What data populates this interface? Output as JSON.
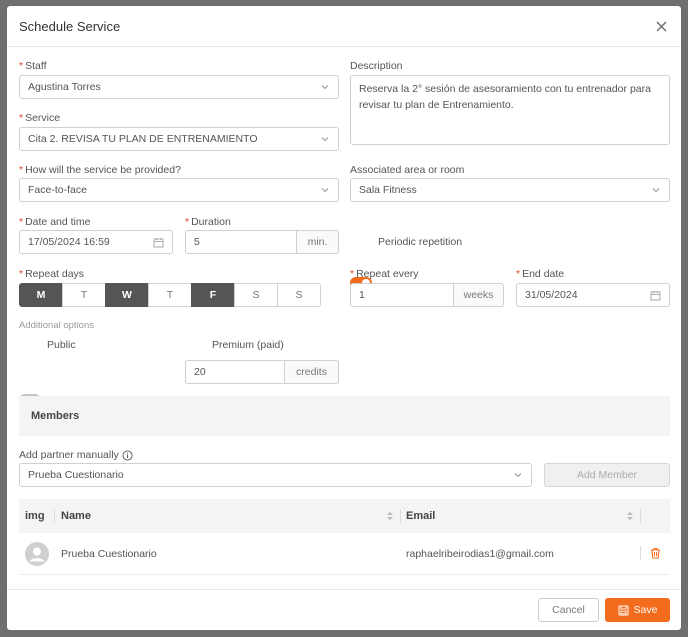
{
  "modal": {
    "title": "Schedule Service"
  },
  "staff": {
    "label": "Staff",
    "value": "Agustina Torres"
  },
  "description": {
    "label": "Description",
    "value": "Reserva la 2° sesión de asesoramiento con tu entrenador para revisar tu plan de Entrenamiento."
  },
  "service": {
    "label": "Service",
    "value": "Cita 2. REVISA TU PLAN DE ENTRENAMIENTO"
  },
  "provision": {
    "label": "How will the service be provided?",
    "value": "Face-to-face"
  },
  "area": {
    "label": "Associated area or room",
    "value": "Sala Fitness"
  },
  "datetime": {
    "label": "Date and time",
    "value": "17/05/2024 16:59"
  },
  "duration": {
    "label": "Duration",
    "value": "5",
    "unit": "min."
  },
  "periodic": {
    "label": "Periodic repetition",
    "enabled": true
  },
  "repeat_days": {
    "label": "Repeat days",
    "days": [
      {
        "label": "M",
        "selected": true
      },
      {
        "label": "T",
        "selected": false
      },
      {
        "label": "W",
        "selected": true
      },
      {
        "label": "T",
        "selected": false
      },
      {
        "label": "F",
        "selected": true
      },
      {
        "label": "S",
        "selected": false
      },
      {
        "label": "S",
        "selected": false
      }
    ]
  },
  "repeat_every": {
    "label": "Repeat every",
    "value": "1",
    "unit": "weeks"
  },
  "end_date": {
    "label": "End date",
    "value": "31/05/2024"
  },
  "additional": {
    "label": "Additional options",
    "public_label": "Public",
    "public_enabled": false,
    "premium_label": "Premium (paid)",
    "premium_enabled": true,
    "credits_value": "20",
    "credits_unit": "credits"
  },
  "members": {
    "title": "Members",
    "add_label": "Add partner manually",
    "add_value": "Prueba Cuestionario",
    "add_button": "Add Member",
    "columns": {
      "img": "img",
      "name": "Name",
      "email": "Email"
    },
    "rows": [
      {
        "name": "Prueba Cuestionario",
        "email": "raphaelribeirodias1@gmail.com"
      }
    ]
  },
  "footer": {
    "cancel": "Cancel",
    "save": "Save"
  },
  "colors": {
    "accent": "#f36b1c",
    "required": "#e0452b",
    "selected_day": "#555555"
  }
}
